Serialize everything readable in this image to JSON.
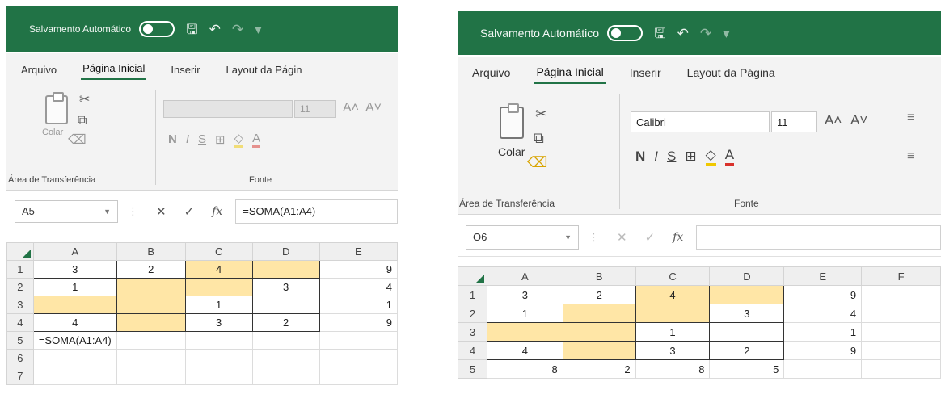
{
  "panes": [
    {
      "title": "Salvamento Automático",
      "tabs": [
        "Arquivo",
        "Página Inicial",
        "Inserir",
        "Layout da Págin"
      ],
      "ribbon": {
        "clipboard_label": "Área de Transferência",
        "paste_label": "Colar",
        "font_group_label": "Fonte",
        "font_name": "",
        "font_size": "11"
      },
      "namebox": "A5",
      "formula": "=SOMA(A1:A4)",
      "columns": [
        "A",
        "B",
        "C",
        "D",
        "E"
      ],
      "rows": [
        {
          "n": "1",
          "cells": [
            "3",
            "2",
            "4",
            "",
            "9"
          ]
        },
        {
          "n": "2",
          "cells": [
            "1",
            "",
            "",
            "3",
            "4"
          ]
        },
        {
          "n": "3",
          "cells": [
            "",
            "",
            "1",
            "",
            "1"
          ]
        },
        {
          "n": "4",
          "cells": [
            "4",
            "",
            "3",
            "2",
            "9"
          ]
        },
        {
          "n": "5",
          "cells": [
            "=SOMA(A1:A4)",
            "",
            "",
            "",
            ""
          ]
        },
        {
          "n": "6",
          "cells": [
            "",
            "",
            "",
            "",
            ""
          ]
        },
        {
          "n": "7",
          "cells": [
            "",
            "",
            "",
            "",
            ""
          ]
        }
      ]
    },
    {
      "title": "Salvamento Automático",
      "tabs": [
        "Arquivo",
        "Página Inicial",
        "Inserir",
        "Layout da Página"
      ],
      "ribbon": {
        "clipboard_label": "Área de Transferência",
        "paste_label": "Colar",
        "font_group_label": "Fonte",
        "font_name": "Calibri",
        "font_size": "11"
      },
      "namebox": "O6",
      "formula": "",
      "columns": [
        "A",
        "B",
        "C",
        "D",
        "E",
        "F"
      ],
      "rows": [
        {
          "n": "1",
          "cells": [
            "3",
            "2",
            "4",
            "",
            "9",
            ""
          ]
        },
        {
          "n": "2",
          "cells": [
            "1",
            "",
            "",
            "3",
            "4",
            ""
          ]
        },
        {
          "n": "3",
          "cells": [
            "",
            "",
            "1",
            "",
            "1",
            ""
          ]
        },
        {
          "n": "4",
          "cells": [
            "4",
            "",
            "3",
            "2",
            "9",
            ""
          ]
        },
        {
          "n": "5",
          "cells": [
            "8",
            "2",
            "8",
            "5",
            "",
            ""
          ]
        }
      ]
    }
  ],
  "highlight_color": "#ffe6a6",
  "accent_color": "#217346"
}
